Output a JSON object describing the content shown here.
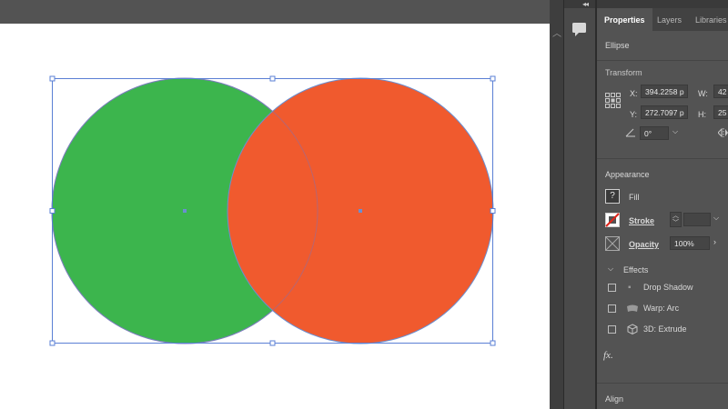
{
  "panel": {
    "tabs": [
      "Properties",
      "Layers",
      "Libraries"
    ],
    "object_type": "Ellipse",
    "transform": {
      "title": "Transform",
      "x_label": "X:",
      "x_value": "394.2258 p",
      "y_label": "Y:",
      "y_value": "272.7097 p",
      "w_label": "W:",
      "w_value": "42",
      "h_label": "H:",
      "h_value": "25",
      "rotate_value": "0°"
    },
    "appearance": {
      "title": "Appearance",
      "fill_label": "Fill",
      "fill_icon_glyph": "?",
      "stroke_label": "Stroke",
      "opacity_label": "Opacity",
      "opacity_value": "100%"
    },
    "effects": {
      "title": "Effects",
      "items": [
        {
          "label": "Drop Shadow",
          "icon": "drop-shadow-icon"
        },
        {
          "label": "Warp: Arc",
          "icon": "warp-arc-icon"
        },
        {
          "label": "3D: Extrude",
          "icon": "cube-icon"
        }
      ],
      "fx_label": "fx."
    },
    "align_title": "Align"
  },
  "colors": {
    "green_fill": "#3cb54d",
    "orange_fill": "#f05a2e",
    "selection": "#5a7fd4",
    "panel_bg": "#535353"
  }
}
